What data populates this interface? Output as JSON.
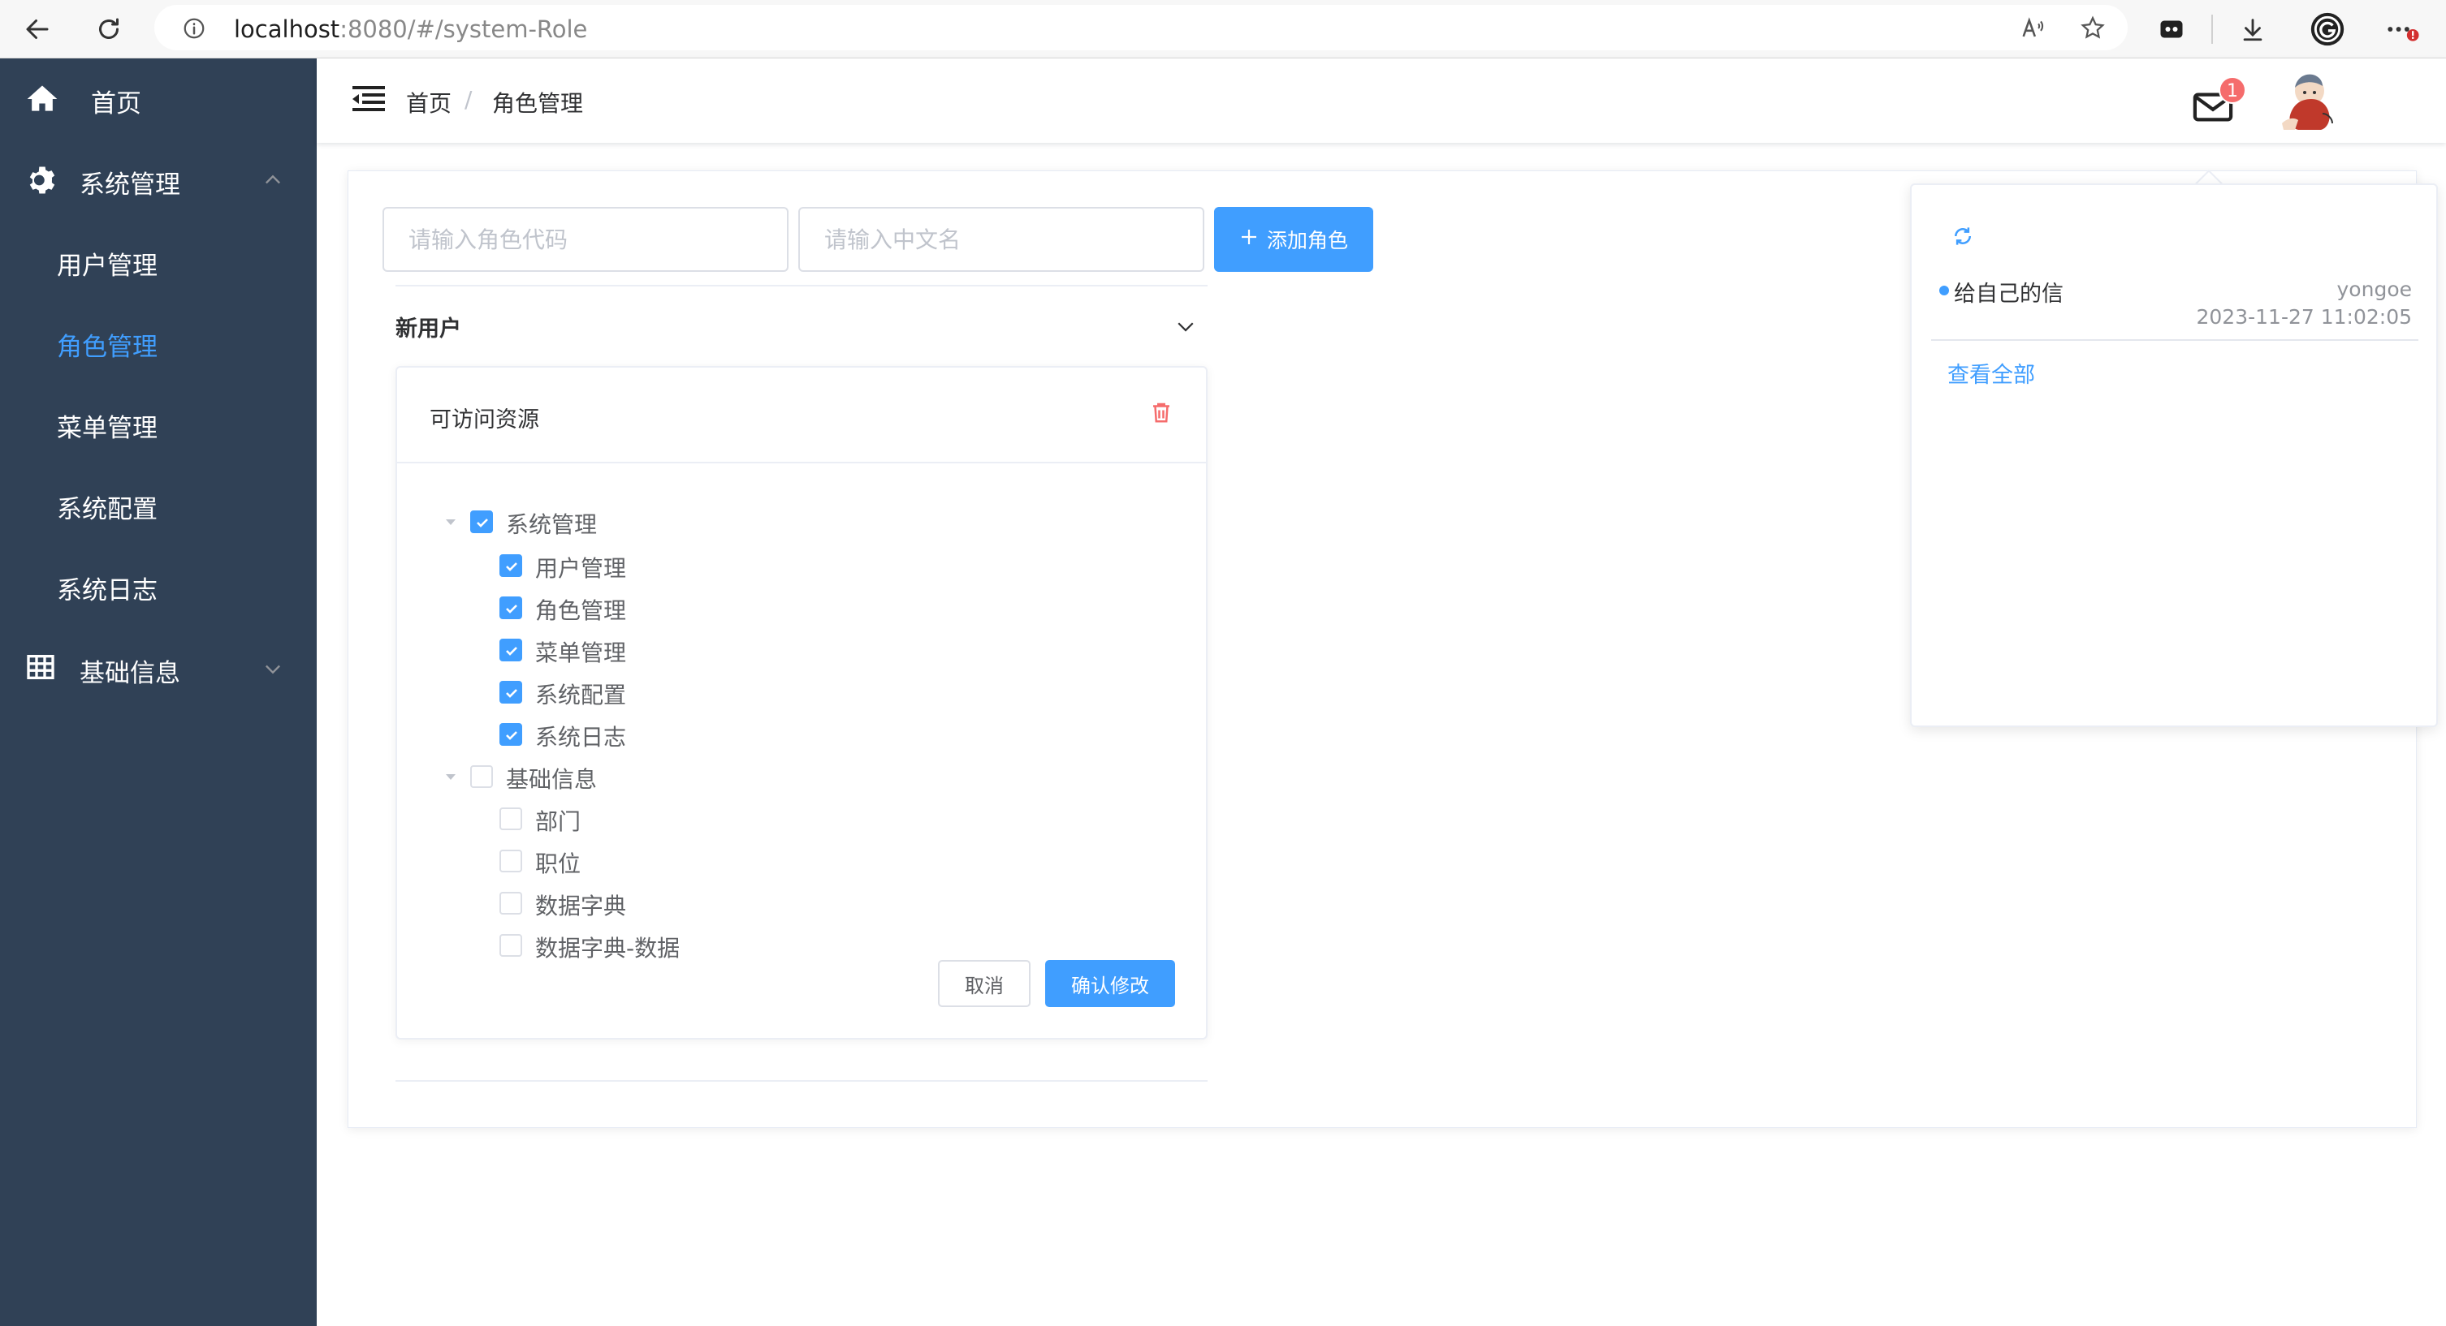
{
  "browser": {
    "url_host": "localhost",
    "url_path": ":8080/#/system-Role"
  },
  "sidebar": {
    "home_label": "首页",
    "system_label": "系统管理",
    "system_children": [
      "用户管理",
      "角色管理",
      "菜单管理",
      "系统配置",
      "系统日志"
    ],
    "active_child": "角色管理",
    "basic_label": "基础信息"
  },
  "navbar": {
    "breadcrumb_home": "首页",
    "breadcrumb_sep": "/",
    "breadcrumb_current": "角色管理",
    "mail_badge": "1"
  },
  "toolbar": {
    "code_placeholder": "请输入角色代码",
    "name_placeholder": "请输入中文名",
    "add_label": "添加角色"
  },
  "role": {
    "name": "新用户",
    "card_title": "可访问资源",
    "tree": [
      {
        "label": "系统管理",
        "checked": true,
        "children": [
          {
            "label": "用户管理",
            "checked": true
          },
          {
            "label": "角色管理",
            "checked": true
          },
          {
            "label": "菜单管理",
            "checked": true
          },
          {
            "label": "系统配置",
            "checked": true
          },
          {
            "label": "系统日志",
            "checked": true
          }
        ]
      },
      {
        "label": "基础信息",
        "checked": false,
        "children": [
          {
            "label": "部门",
            "checked": false
          },
          {
            "label": "职位",
            "checked": false
          },
          {
            "label": "数据字典",
            "checked": false
          },
          {
            "label": "数据字典-数据",
            "checked": false
          }
        ]
      }
    ],
    "cancel_label": "取消",
    "confirm_label": "确认修改"
  },
  "notifications": {
    "items": [
      {
        "title": "给自己的信",
        "sender": "yongoe",
        "time": "2023-11-27 11:02:05"
      }
    ],
    "view_all": "查看全部"
  },
  "colors": {
    "sidebar_bg": "#304156",
    "accent": "#409eff",
    "danger": "#f56c6c"
  }
}
